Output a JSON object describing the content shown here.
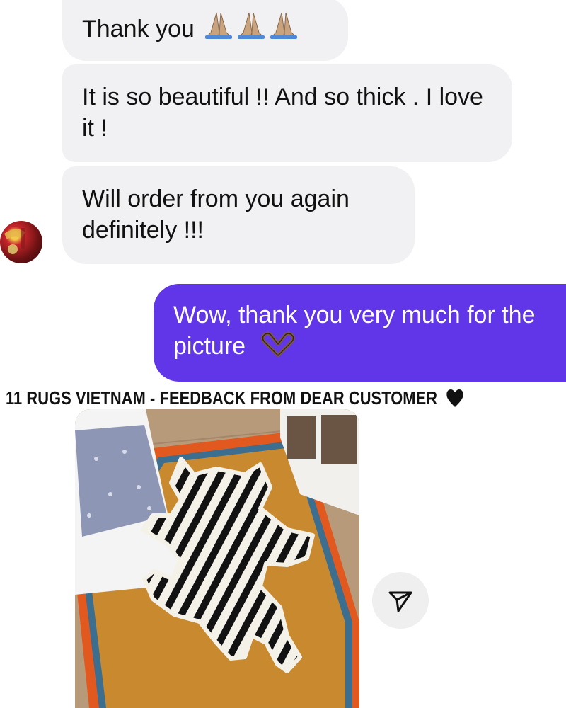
{
  "messages": {
    "incoming": [
      {
        "text": "Thank you",
        "emoji": "folded-hands x3"
      },
      {
        "text": "It is so beautiful !! And so thick . I love it !"
      },
      {
        "text": "Will order from you again definitely !!!"
      }
    ],
    "outgoing": [
      {
        "text": "Wow, thank you very much for the picture",
        "emoji": "heart-hands"
      }
    ]
  },
  "caption": {
    "text": "11 RUGS VIETNAM - FEEDBACK FROM DEAR CUSTOMER",
    "emoji": "black-heart"
  },
  "photo": {
    "icon": "zebra-rug-photo"
  },
  "share": {
    "icon": "paper-plane-icon"
  },
  "colors": {
    "incoming_bubble": "#f1f1f3",
    "outgoing_bubble": "#6135e8",
    "share_button": "#efefef"
  }
}
